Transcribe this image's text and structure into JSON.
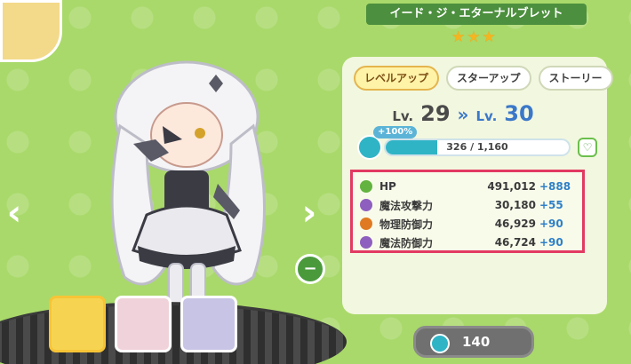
{
  "character": {
    "name": "イード・ジ・エターナルブレット",
    "stars": [
      "★",
      "★",
      "★"
    ]
  },
  "tabs": [
    {
      "label": "レベルアップ",
      "active": true
    },
    {
      "label": "スターアップ",
      "active": false
    },
    {
      "label": "ストーリー",
      "active": false
    }
  ],
  "level": {
    "prefix": "Lv.",
    "current": "29",
    "arrow": "»",
    "new_prefix": "Lv.",
    "new": "30"
  },
  "exp": {
    "bonus": "+100%",
    "text": "326 / 1,160",
    "progress": 0.281
  },
  "stats": [
    {
      "icon": "heart-icon",
      "label": "HP",
      "value": "491,012",
      "bonus": "+888",
      "color": "#62b33f"
    },
    {
      "icon": "magic-attack-icon",
      "label": "魔法攻撃力",
      "value": "30,180",
      "bonus": "+55",
      "color": "#8e5fbf"
    },
    {
      "icon": "physical-defense-icon",
      "label": "物理防御力",
      "value": "46,929",
      "bonus": "+90",
      "color": "#e07a22"
    },
    {
      "icon": "magic-defense-icon",
      "label": "魔法防御力",
      "value": "46,724",
      "bonus": "+90",
      "color": "#8e5fbf"
    }
  ],
  "confirm": {
    "count": "140"
  },
  "colors": {
    "background": "#a9d96a",
    "accent_blue": "#2fb4c6",
    "highlight_red": "#e23a62"
  }
}
